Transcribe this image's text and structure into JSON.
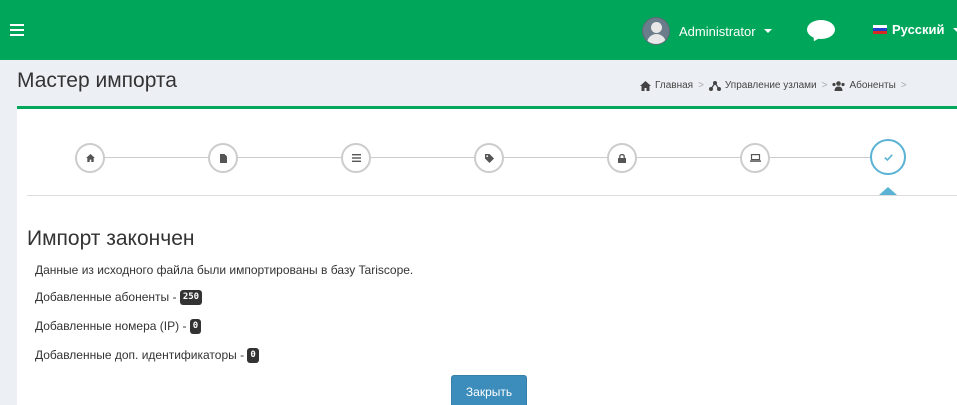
{
  "topbar": {
    "user_name": "Administrator",
    "language": "Русский",
    "accent_color": "#00a65a"
  },
  "header": {
    "title": "Мастер импорта",
    "breadcrumb": [
      {
        "label": "Главная",
        "icon": "home-icon"
      },
      {
        "label": "Управление узлами",
        "icon": "sitemap-icon"
      },
      {
        "label": "Абоненты",
        "icon": "users-icon"
      }
    ]
  },
  "wizard": {
    "steps": [
      {
        "icon": "home-icon",
        "state": "done"
      },
      {
        "icon": "file-icon",
        "state": "done"
      },
      {
        "icon": "list-icon",
        "state": "done"
      },
      {
        "icon": "tag-icon",
        "state": "done"
      },
      {
        "icon": "lock-icon",
        "state": "done"
      },
      {
        "icon": "laptop-icon",
        "state": "done"
      },
      {
        "icon": "check-icon",
        "state": "current"
      }
    ],
    "step_color": "#5ab3d4"
  },
  "result": {
    "title": "Импорт закончен",
    "message": "Данные из исходного файла были импортированы в базу Tariscope.",
    "added_subscribers_label": "Добавленные абоненты - ",
    "added_subscribers_count": "250",
    "added_numbers_label": "Добавленные номера (IP) - ",
    "added_numbers_count": "0",
    "added_ids_label": "Добавленные доп. идентификаторы - ",
    "added_ids_count": "0",
    "close_label": "Закрыть"
  }
}
